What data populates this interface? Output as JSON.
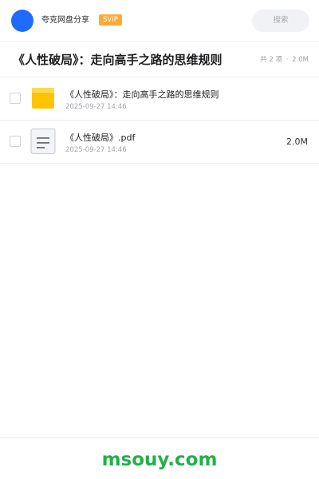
{
  "header": {
    "app_name": "夸克网盘分享",
    "badge": "SVIP",
    "search_placeholder": "搜索"
  },
  "folder": {
    "title": "《人性破局》：走向高手之路的思维规则",
    "meta_count": "共 2 项",
    "meta_sep": "·",
    "meta_size": "2.0M"
  },
  "files": [
    {
      "name": "《人性破局》：走向高手之路的思维规则",
      "date": "2025-09-27 14:46",
      "size": "",
      "icon": "folder-icon"
    },
    {
      "name": "《人性破局》.pdf",
      "date": "2025-09-27 14:46",
      "size": "2.0M",
      "icon": "document-icon"
    }
  ],
  "footer": {
    "watermark": "msouy.com"
  },
  "colors": {
    "avatar": "#1f6bff",
    "badge": "#ffaa33",
    "folder": "#ffc400",
    "watermark": "#22b048"
  }
}
